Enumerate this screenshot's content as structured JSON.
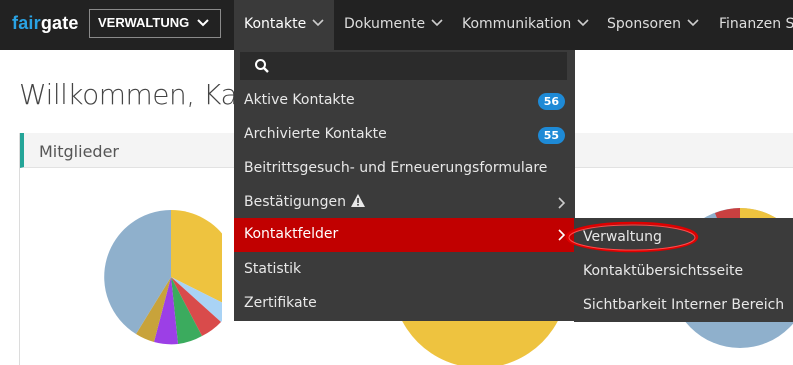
{
  "topbar": {
    "logo_prefix": "fair",
    "logo_suffix": "gate",
    "context_selector": "VERWALTUNG",
    "nav": [
      {
        "label": "Kontakte",
        "active": true
      },
      {
        "label": "Dokumente"
      },
      {
        "label": "Kommunikation"
      },
      {
        "label": "Sponsoren"
      },
      {
        "label": "Finanzen Si"
      }
    ]
  },
  "page": {
    "title": "Willkommen, Kare",
    "panel_title": "Mitglieder"
  },
  "dropdown": {
    "search_placeholder": "",
    "items": [
      {
        "label": "Aktive Kontakte",
        "badge": "56"
      },
      {
        "label": "Archivierte Kontakte",
        "badge": "55"
      },
      {
        "label": "Beitrittsgesuch- und Erneuerungsformulare"
      },
      {
        "label": "Bestätigungen",
        "icon": "warning-icon",
        "has_submenu": true
      },
      {
        "label": "Kontaktfelder",
        "active": true,
        "has_submenu": true
      },
      {
        "label": "Statistik"
      },
      {
        "label": "Zertifikate"
      }
    ]
  },
  "submenu": {
    "items": [
      {
        "label": "Verwaltung",
        "highlighted": true
      },
      {
        "label": "Kontaktübersichtsseite"
      },
      {
        "label": "Sichtbarkeit Interner Bereich"
      }
    ]
  },
  "colors": {
    "topbar": "#222222",
    "dropdown": "#3b3b3b",
    "active_item": "#c10000",
    "badge": "#1e8ad6",
    "panel_accent": "#24a598",
    "logo_accent": "#2aa3e4",
    "highlight_ring": "#e00000"
  }
}
